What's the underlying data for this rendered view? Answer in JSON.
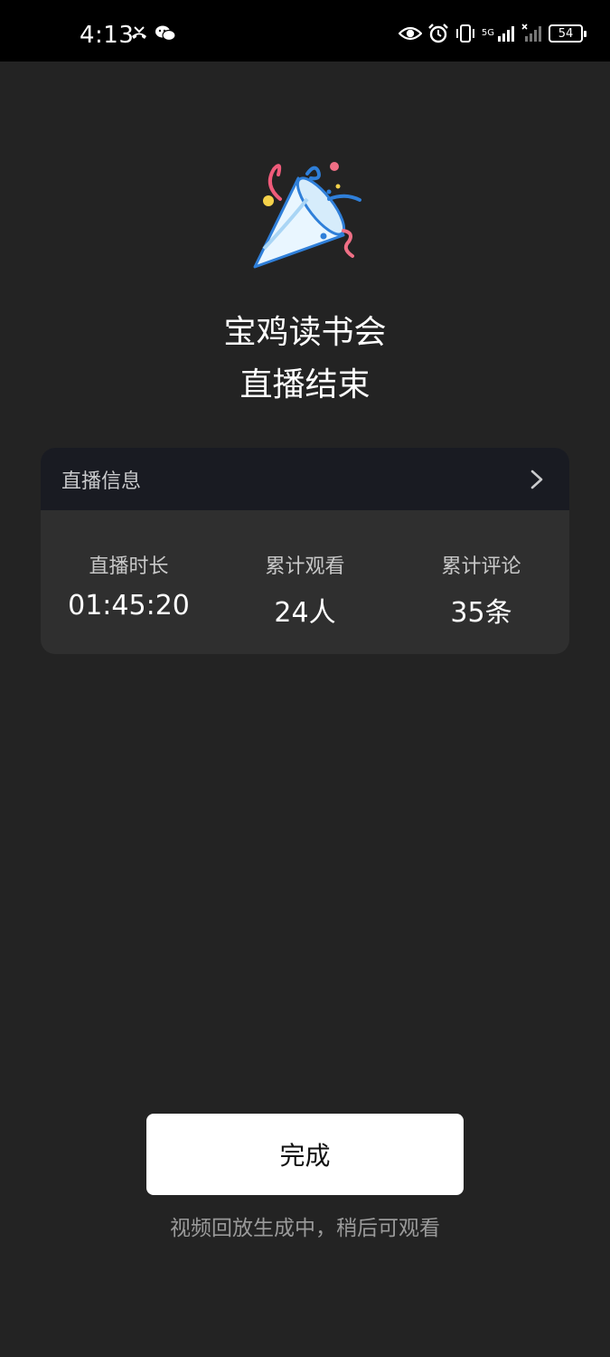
{
  "status_bar": {
    "time": "4:13",
    "left_icons": [
      "missed-call-icon",
      "wechat-icon"
    ],
    "right_icons": [
      "eye-icon",
      "alarm-icon",
      "vibrate-icon",
      "signal-5g-icon",
      "signal-icon"
    ],
    "network_label": "5G",
    "battery": "54"
  },
  "header": {
    "icon": "party-popper-icon",
    "title": "宝鸡读书会",
    "subtitle": "直播结束"
  },
  "info_card": {
    "title": "直播信息",
    "stats": [
      {
        "label": "直播时长",
        "value": "01:45:20"
      },
      {
        "label": "累计观看",
        "value": "24人"
      },
      {
        "label": "累计评论",
        "value": "35条"
      }
    ]
  },
  "actions": {
    "done_label": "完成",
    "replay_note": "视频回放生成中，稍后可观看"
  },
  "colors": {
    "background": "#232323",
    "card": "#2f2f2f",
    "card_header": "#191b22",
    "button": "#ffffff"
  }
}
